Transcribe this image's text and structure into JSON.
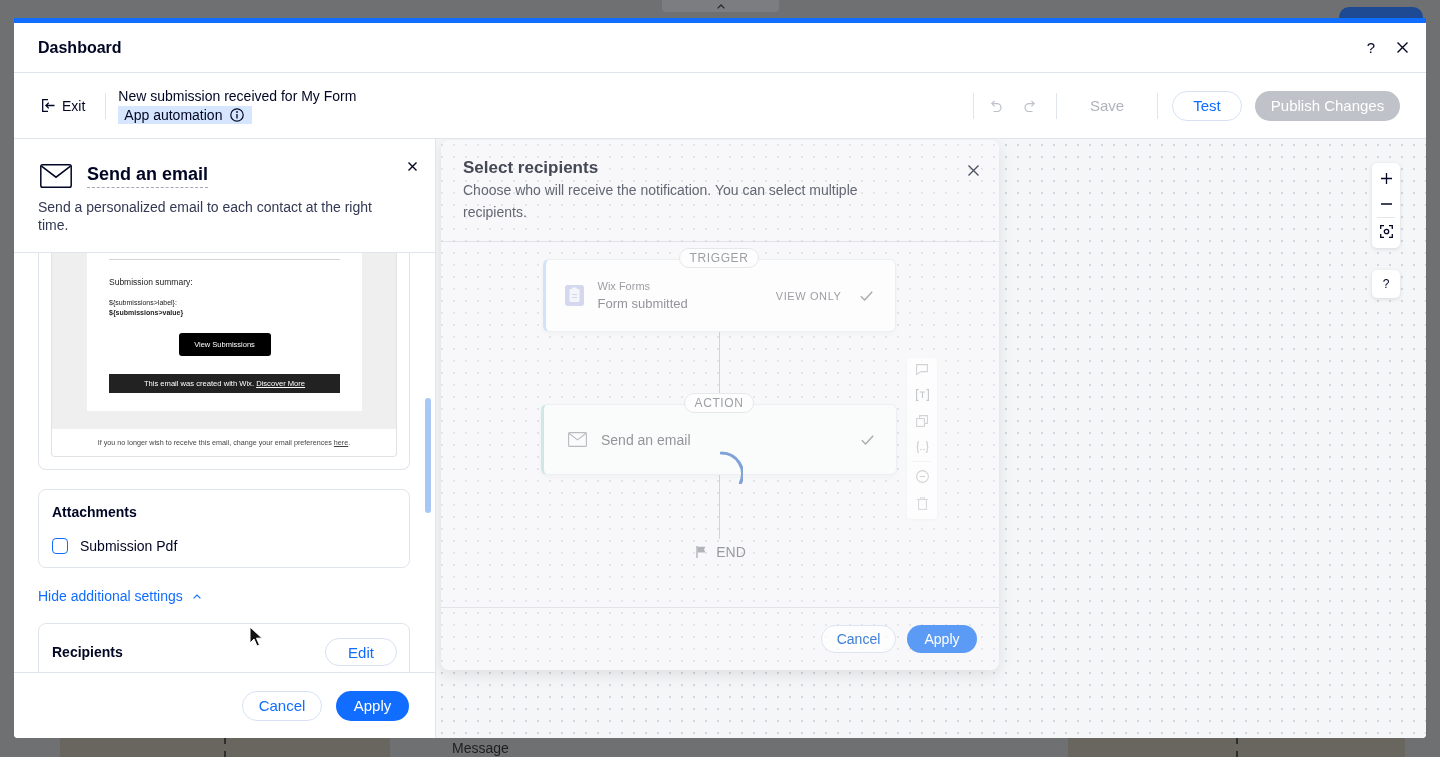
{
  "backdrop": {
    "label": "Message"
  },
  "dashboard": {
    "title": "Dashboard",
    "help": "?"
  },
  "toolbar": {
    "exit": "Exit",
    "title": "New submission received for My Form",
    "badge": "App automation",
    "history": [
      {
        "kind": "undo",
        "disabled": true
      },
      {
        "kind": "redo",
        "disabled": true
      }
    ],
    "actions": [
      {
        "kind": "text",
        "label": "Save",
        "disabled": true
      },
      {
        "kind": "outline",
        "label": "Test",
        "disabled": false
      },
      {
        "kind": "primary",
        "label": "Publish Changes",
        "disabled": true
      }
    ]
  },
  "action_panel": {
    "title": "Send an email",
    "description": "Send a personalized email to each contact at the right time.",
    "email_preview": {
      "heading": "Submission summary:",
      "field_label": "${submissions>label}:",
      "field_value": "${submissions>value}",
      "button": "View Submissions",
      "banner": "This email was created with Wix.",
      "banner_link": "Discover More",
      "footer": "If you no longer wish to receive this email, change your email preferences",
      "footer_link": "here",
      "footer_end": "."
    },
    "attachments": {
      "title": "Attachments",
      "options": [
        {
          "label": "Submission Pdf",
          "checked": false
        }
      ]
    },
    "settings_toggle": {
      "label": "Hide additional settings",
      "expanded": true
    },
    "recipients": {
      "title": "Recipients",
      "edit": "Edit"
    },
    "footer": {
      "cancel": "Cancel",
      "apply": "Apply"
    }
  },
  "workflow": {
    "nodes": [
      {
        "kind": "trigger",
        "tag": "TRIGGER",
        "app": "Wix Forms",
        "title": "Form submitted",
        "status": "VIEW ONLY",
        "configured": true
      },
      {
        "kind": "action",
        "tag": "ACTION",
        "title": "Send an email",
        "configured": true,
        "loading": true
      }
    ],
    "end": "END"
  },
  "canvas_controls": {
    "help": "?"
  },
  "recipients_dialog": {
    "title": "Select recipients",
    "description": "Choose who will receive the notification. You can select multiple recipients.",
    "cancel": "Cancel",
    "apply": "Apply"
  }
}
